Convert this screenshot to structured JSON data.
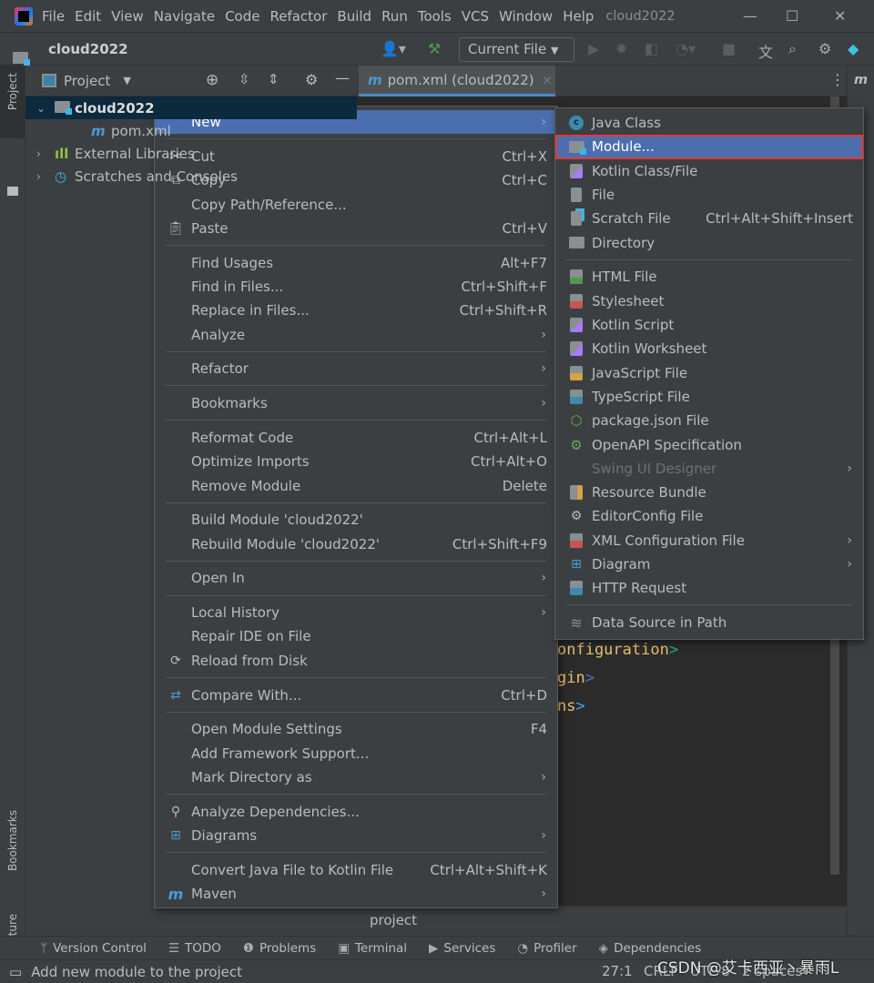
{
  "titlebar": {
    "menus": [
      "File",
      "Edit",
      "View",
      "Navigate",
      "Code",
      "Refactor",
      "Build",
      "Run",
      "Tools",
      "VCS",
      "Window",
      "Help"
    ],
    "title": "cloud2022"
  },
  "navbar": {
    "project": "cloud2022",
    "run_config": "Current File"
  },
  "project_panel": {
    "title": "Project",
    "stripe_label": "Project",
    "tree": [
      {
        "label": "cloud2022",
        "level": 0,
        "expanded": true,
        "selected": true,
        "icon": "module-folder-icon"
      },
      {
        "label": "pom.xml",
        "level": 1,
        "icon": "maven-icon"
      },
      {
        "label": "External Libraries",
        "level": 0,
        "icon": "libraries-icon"
      },
      {
        "label": "Scratches and Consoles",
        "level": 0,
        "icon": "scratches-icon"
      }
    ]
  },
  "left_stripe": {
    "bookmarks": "Bookmarks",
    "structure": "Structure"
  },
  "editor": {
    "tab": "pom.xml (cloud2022)",
    "lines": [
      {
        "text": "onfiguration",
        "bracket": ">",
        "bracket_color": "#26a69a"
      },
      {
        "text": "gin",
        "bracket": ">",
        "bracket_color": "#5c6bc0"
      },
      {
        "text": "ns",
        "bracket": ">",
        "bracket_color": "#42a5f5"
      }
    ],
    "breadcrumb": "project"
  },
  "context_menu": [
    {
      "label": "New",
      "submenu": true,
      "selected": true
    },
    {
      "sep": true
    },
    {
      "label": "Cut",
      "shortcut": "Ctrl+X",
      "icon": "scissors-icon"
    },
    {
      "label": "Copy",
      "shortcut": "Ctrl+C",
      "icon": "copy-icon"
    },
    {
      "label": "Copy Path/Reference..."
    },
    {
      "label": "Paste",
      "shortcut": "Ctrl+V",
      "icon": "paste-icon"
    },
    {
      "sep": true
    },
    {
      "label": "Find Usages",
      "shortcut": "Alt+F7"
    },
    {
      "label": "Find in Files...",
      "shortcut": "Ctrl+Shift+F"
    },
    {
      "label": "Replace in Files...",
      "shortcut": "Ctrl+Shift+R"
    },
    {
      "label": "Analyze",
      "submenu": true
    },
    {
      "sep": true
    },
    {
      "label": "Refactor",
      "submenu": true
    },
    {
      "sep": true
    },
    {
      "label": "Bookmarks",
      "submenu": true
    },
    {
      "sep": true
    },
    {
      "label": "Reformat Code",
      "shortcut": "Ctrl+Alt+L"
    },
    {
      "label": "Optimize Imports",
      "shortcut": "Ctrl+Alt+O"
    },
    {
      "label": "Remove Module",
      "shortcut": "Delete"
    },
    {
      "sep": true
    },
    {
      "label": "Build Module 'cloud2022'"
    },
    {
      "label": "Rebuild Module 'cloud2022'",
      "shortcut": "Ctrl+Shift+F9"
    },
    {
      "sep": true
    },
    {
      "label": "Open In",
      "submenu": true
    },
    {
      "sep": true
    },
    {
      "label": "Local History",
      "submenu": true
    },
    {
      "label": "Repair IDE on File"
    },
    {
      "label": "Reload from Disk",
      "icon": "reload-icon"
    },
    {
      "sep": true
    },
    {
      "label": "Compare With...",
      "shortcut": "Ctrl+D",
      "icon": "compare-icon"
    },
    {
      "sep": true
    },
    {
      "label": "Open Module Settings",
      "shortcut": "F4"
    },
    {
      "label": "Add Framework Support..."
    },
    {
      "label": "Mark Directory as",
      "submenu": true
    },
    {
      "sep": true
    },
    {
      "label": "Analyze Dependencies...",
      "icon": "analyze-dependencies-icon"
    },
    {
      "label": "Diagrams",
      "submenu": true,
      "icon": "diagram-icon"
    },
    {
      "sep": true
    },
    {
      "label": "Convert Java File to Kotlin File",
      "shortcut": "Ctrl+Alt+Shift+K"
    },
    {
      "label": "Maven",
      "submenu": true,
      "icon": "maven-icon"
    }
  ],
  "new_submenu": [
    {
      "label": "Java Class",
      "icon": "java-class-icon"
    },
    {
      "label": "Module...",
      "icon": "module-folder-icon",
      "selected": true,
      "highlighted_box": true
    },
    {
      "label": "Kotlin Class/File",
      "icon": "kotlin-file-icon"
    },
    {
      "label": "File",
      "icon": "file-icon"
    },
    {
      "label": "Scratch File",
      "shortcut": "Ctrl+Alt+Shift+Insert",
      "icon": "scratch-file-icon"
    },
    {
      "label": "Directory",
      "icon": "folder-icon"
    },
    {
      "sep": true
    },
    {
      "label": "HTML File",
      "icon": "html-icon"
    },
    {
      "label": "Stylesheet",
      "icon": "css-icon"
    },
    {
      "label": "Kotlin Script",
      "icon": "kotlin-script-icon"
    },
    {
      "label": "Kotlin Worksheet",
      "icon": "kotlin-worksheet-icon"
    },
    {
      "label": "JavaScript File",
      "icon": "javascript-icon"
    },
    {
      "label": "TypeScript File",
      "icon": "typescript-icon"
    },
    {
      "label": "package.json File",
      "icon": "nodejs-icon"
    },
    {
      "label": "OpenAPI Specification",
      "icon": "openapi-icon"
    },
    {
      "label": "Swing UI Designer",
      "submenu": true,
      "disabled": true
    },
    {
      "label": "Resource Bundle",
      "icon": "resource-bundle-icon"
    },
    {
      "label": "EditorConfig File",
      "icon": "editorconfig-icon"
    },
    {
      "label": "XML Configuration File",
      "submenu": true,
      "icon": "xml-icon"
    },
    {
      "label": "Diagram",
      "submenu": true,
      "icon": "diagram-icon"
    },
    {
      "label": "HTTP Request",
      "icon": "api-icon"
    },
    {
      "sep": true
    },
    {
      "label": "Data Source in Path",
      "icon": "database-icon"
    }
  ],
  "bottom_tools": [
    {
      "label": "Version Control",
      "icon": "vcs-icon"
    },
    {
      "label": "TODO",
      "icon": "list-icon"
    },
    {
      "label": "Problems",
      "icon": "problems-icon"
    },
    {
      "label": "Terminal",
      "icon": "terminal-icon"
    },
    {
      "label": "Services",
      "icon": "services-icon"
    },
    {
      "label": "Profiler",
      "icon": "profiler-icon"
    },
    {
      "label": "Dependencies",
      "icon": "dependencies-icon"
    }
  ],
  "status": {
    "message": "Add new module to the project",
    "position": "27:1",
    "line_sep": "CRLF",
    "encoding": "UTF-8",
    "indent": "2 spaces*",
    "watermark": "CSDN @艾卡西亚丶暴雨L"
  },
  "colors": {
    "accent": "#4b6eaf",
    "selection_tree": "#0d293e",
    "highlight_box": "#e23a3a"
  }
}
